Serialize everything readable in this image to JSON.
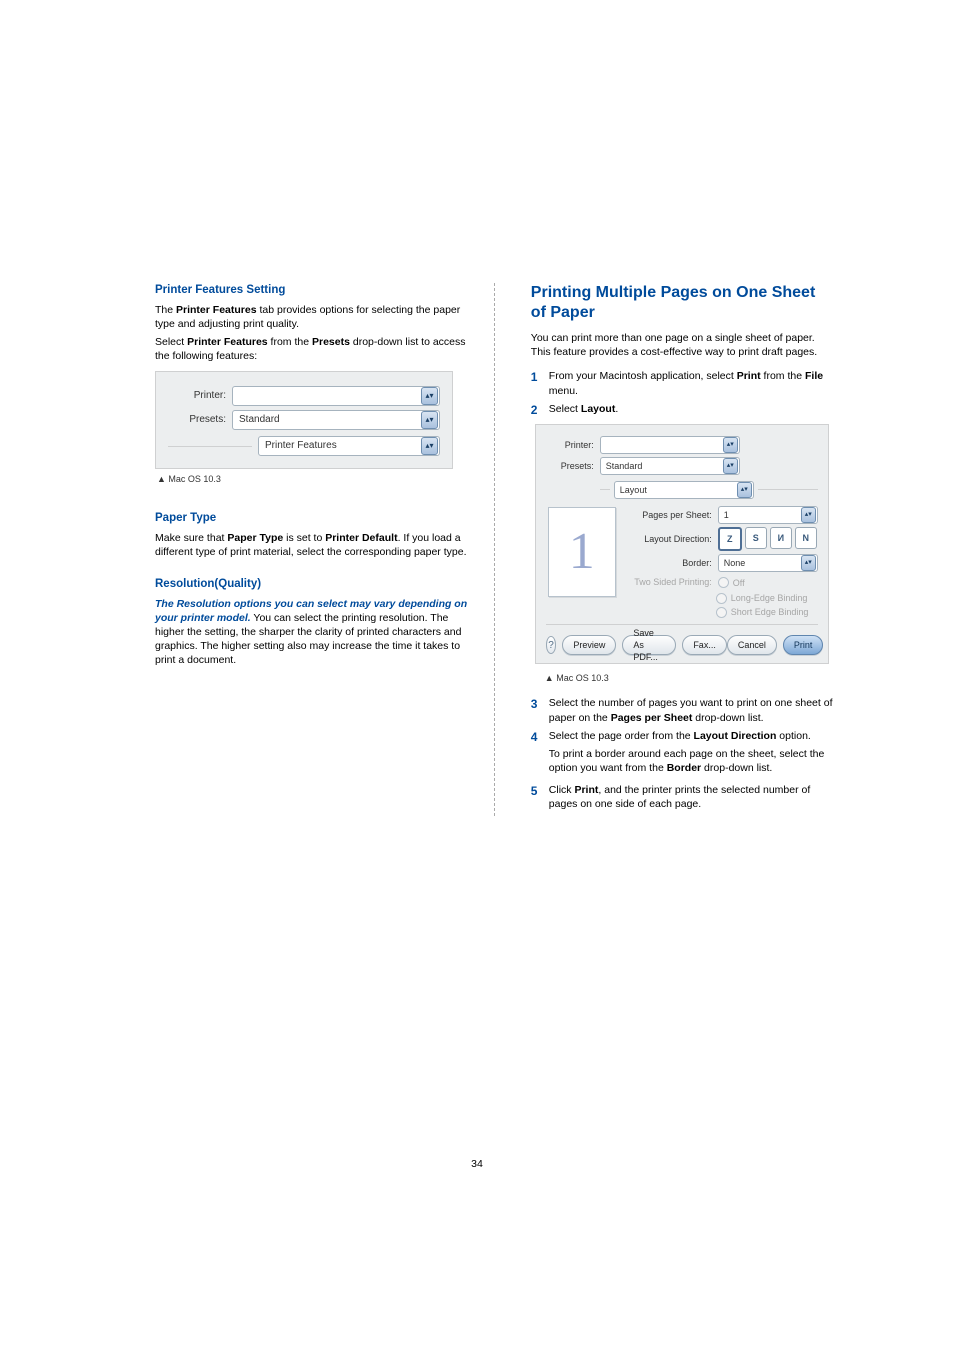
{
  "left": {
    "h3a": "Printer Features Setting",
    "p1a": "The ",
    "p1b": "Printer Features",
    "p1c": " tab provides options for selecting the paper type and adjusting print quality.",
    "p2a": "Select ",
    "p2b": "Printer Features",
    "p2c": " from the ",
    "p2d": "Presets",
    "p2e": " drop-down list to access the following features:",
    "dlg": {
      "printer_label": "Printer:",
      "printer_value": "",
      "presets_label": "Presets:",
      "presets_value": "Standard",
      "section_value": "Printer Features"
    },
    "caption1": "▲ Mac OS 10.3",
    "h3b": "Paper Type",
    "p3a": "Make sure that ",
    "p3b": "Paper Type",
    "p3c": " is set to ",
    "p3d": "Printer Default",
    "p3e": ". If you load a different type of print material, select the corresponding paper type.",
    "h3c": "Resolution(Quality)",
    "p4italic": "The Resolution options you can select may vary depending on your printer model.",
    "p4rest": " You can select the printing resolution. The higher the setting, the sharper the clarity of printed characters and graphics. The higher setting also may increase the time it takes to print a document."
  },
  "right": {
    "h2": "Printing Multiple Pages on One Sheet of Paper",
    "intro": "You can print more than one page on a single sheet of paper. This feature provides a cost-effective way to print draft pages.",
    "steps": {
      "s1a": "From your Macintosh application, select ",
      "s1b": "Print",
      "s1c": " from the ",
      "s1d": "File",
      "s1e": " menu.",
      "s2a": "Select ",
      "s2b": "Layout",
      "s2c": ".",
      "s3a": "Select the number of pages you want to print on one sheet of paper on the ",
      "s3b": "Pages per Sheet",
      "s3c": " drop-down list.",
      "s4a": "Select the page order from the ",
      "s4b": "Layout Direction",
      "s4c": " option.",
      "s4d": "To print a border around each page on the sheet, select the option you want from the ",
      "s4e": "Border",
      "s4f": " drop-down list.",
      "s5a": "Click ",
      "s5b": "Print",
      "s5c": ", and the printer prints the selected number of pages on one side of each page."
    },
    "dlg": {
      "printer_label": "Printer:",
      "printer_value": "",
      "presets_label": "Presets:",
      "presets_value": "Standard",
      "section": "Layout",
      "pps_label": "Pages per Sheet:",
      "pps_value": "1",
      "dir_label": "Layout Direction:",
      "border_label": "Border:",
      "border_value": "None",
      "twosided_label": "Two Sided Printing:",
      "r1": "Off",
      "r2": "Long-Edge Binding",
      "r3": "Short Edge Binding",
      "preview_digit": "1",
      "btn_help": "?",
      "btn_preview": "Preview",
      "btn_savepdf": "Save As PDF...",
      "btn_fax": "Fax...",
      "btn_cancel": "Cancel",
      "btn_print": "Print"
    },
    "caption2": "▲ Mac OS 10.3"
  },
  "page_num": "34"
}
